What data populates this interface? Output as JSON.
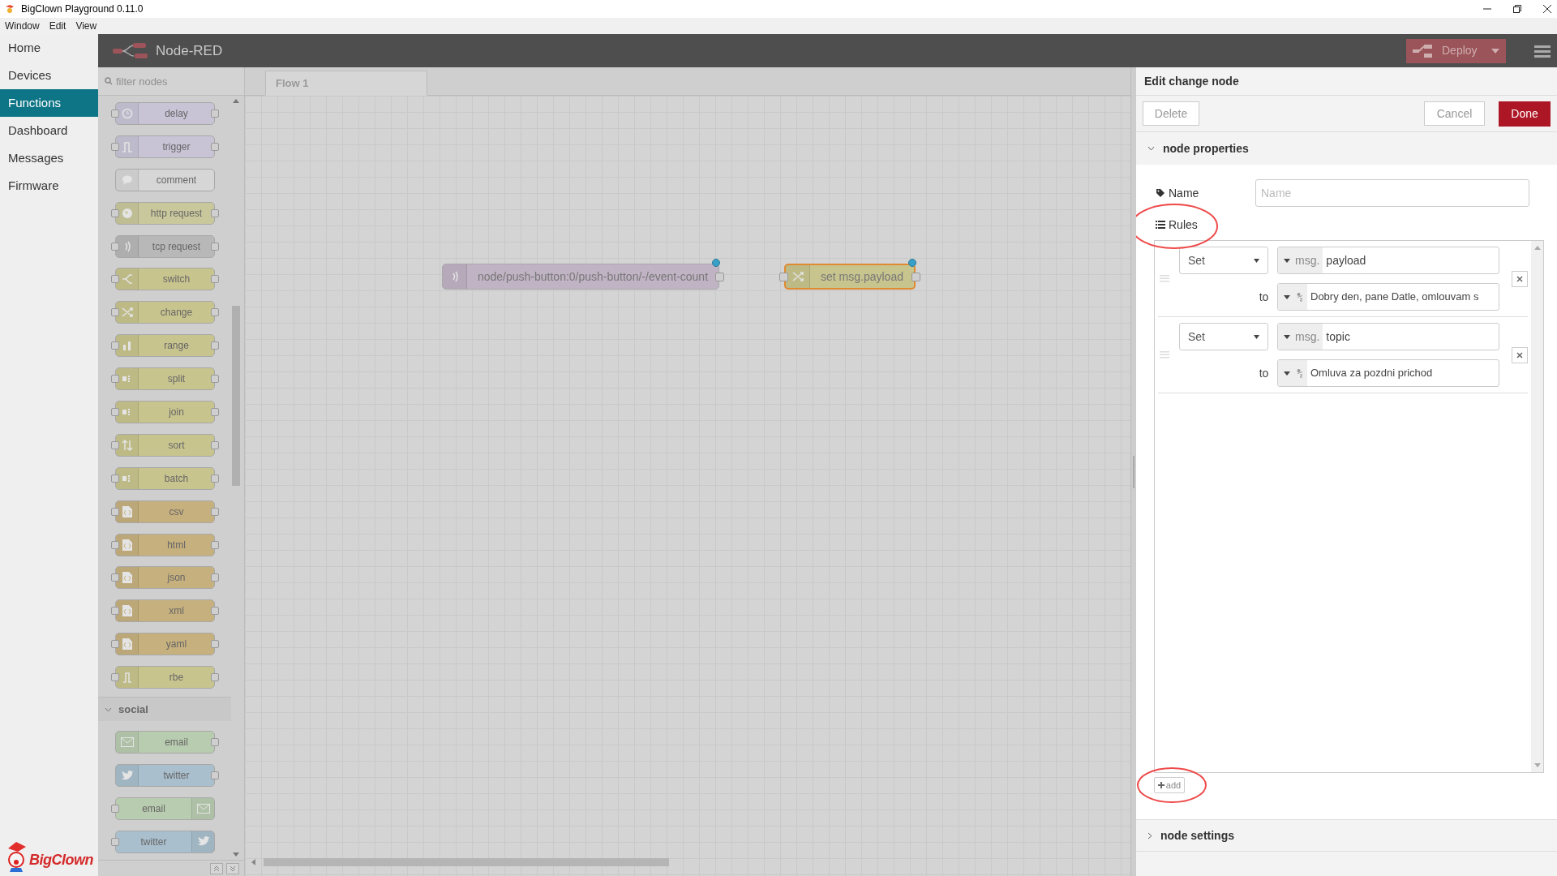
{
  "window": {
    "title": "BigClown Playground 0.11.0"
  },
  "menu_bar": [
    "Window",
    "Edit",
    "View"
  ],
  "nav": [
    {
      "label": "Home",
      "selected": false
    },
    {
      "label": "Devices",
      "selected": false
    },
    {
      "label": "Functions",
      "selected": true
    },
    {
      "label": "Dashboard",
      "selected": false
    },
    {
      "label": "Messages",
      "selected": false
    },
    {
      "label": "Firmware",
      "selected": false
    }
  ],
  "logo": "BigClown",
  "header": {
    "title": "Node-RED",
    "deploy": "Deploy"
  },
  "palette": {
    "placeholder": "filter nodes",
    "nodes": [
      {
        "label": "delay",
        "color": "#c8c4d6",
        "kind": "both"
      },
      {
        "label": "trigger",
        "color": "#c8c4d6",
        "kind": "both"
      },
      {
        "label": "comment",
        "color": "#d6d6d6",
        "kind": "none"
      },
      {
        "label": "http request",
        "color": "#c9c89c",
        "kind": "both"
      },
      {
        "label": "tcp request",
        "color": "#b8b8b8",
        "kind": "both"
      },
      {
        "label": "switch",
        "color": "#c8c48e",
        "kind": "both"
      },
      {
        "label": "change",
        "color": "#c8c48e",
        "kind": "both"
      },
      {
        "label": "range",
        "color": "#c8c48e",
        "kind": "both"
      },
      {
        "label": "split",
        "color": "#c8c48e",
        "kind": "both"
      },
      {
        "label": "join",
        "color": "#c8c48e",
        "kind": "both"
      },
      {
        "label": "sort",
        "color": "#c8c48e",
        "kind": "both"
      },
      {
        "label": "batch",
        "color": "#c8c48e",
        "kind": "both"
      },
      {
        "label": "csv",
        "color": "#c6b07e",
        "kind": "both"
      },
      {
        "label": "html",
        "color": "#c6b07e",
        "kind": "both"
      },
      {
        "label": "json",
        "color": "#c6b07e",
        "kind": "both"
      },
      {
        "label": "xml",
        "color": "#c6b07e",
        "kind": "both"
      },
      {
        "label": "yaml",
        "color": "#c6b07e",
        "kind": "both"
      },
      {
        "label": "rbe",
        "color": "#c8c48e",
        "kind": "both"
      }
    ],
    "category": {
      "label": "social",
      "expanded": true
    },
    "category_nodes": [
      {
        "label": "email",
        "color": "#b8ccaf",
        "kind": "source"
      },
      {
        "label": "twitter",
        "color": "#a9bfcd",
        "kind": "source"
      },
      {
        "label": "email",
        "color": "#b8ccaf",
        "kind": "sink"
      },
      {
        "label": "twitter",
        "color": "#a9bfcd",
        "kind": "sink"
      }
    ]
  },
  "canvas": {
    "tabs": [
      {
        "label": "Flow 1",
        "selected": true
      }
    ],
    "nodes": [
      {
        "label": "node/push-button:0/push-button/-/event-count",
        "color": "#c0b3c4",
        "kind": "source",
        "selected": false,
        "changed": true
      },
      {
        "label": "set msg.payload",
        "color": "#c8c48e",
        "kind": "both",
        "selected": true,
        "changed": true
      }
    ]
  },
  "editor": {
    "title": "Edit change node",
    "delete": "Delete",
    "cancel": "Cancel",
    "done": "Done",
    "properties": {
      "label": "node properties",
      "expanded": true
    },
    "name_label": "Name",
    "name_placeholder": "Name",
    "rules_label": "Rules",
    "rules": [
      {
        "action": "Set",
        "prefix": "msg.",
        "property": "payload",
        "to_label": "to",
        "value": "Dobry den, pane Datle, omlouvam s"
      },
      {
        "action": "Set",
        "prefix": "msg.",
        "property": "topic",
        "to_label": "to",
        "value": "Omluva za pozdni prichod"
      }
    ],
    "add": "add",
    "settings": {
      "label": "node settings",
      "expanded": false
    }
  }
}
